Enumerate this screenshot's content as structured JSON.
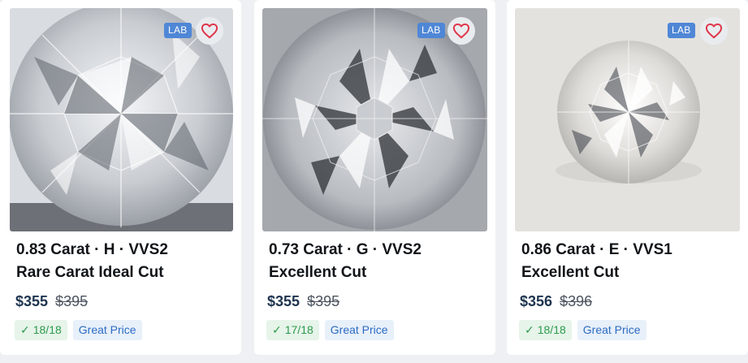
{
  "listings": [
    {
      "badge": "LAB",
      "title_line1": "0.83 Carat · H · VVS2",
      "title_line2": "Rare Carat Ideal Cut",
      "price": "$355",
      "old_price": "$395",
      "score": "18/18",
      "deal_label": "Great Price"
    },
    {
      "badge": "LAB",
      "title_line1": "0.73 Carat · G · VVS2",
      "title_line2": "Excellent Cut",
      "price": "$355",
      "old_price": "$395",
      "score": "17/18",
      "deal_label": "Great Price"
    },
    {
      "badge": "LAB",
      "title_line1": "0.86 Carat · E · VVS1",
      "title_line2": "Excellent Cut",
      "price": "$356",
      "old_price": "$396",
      "score": "18/18",
      "deal_label": "Great Price"
    }
  ],
  "colors": {
    "heart": "#e0364a",
    "badge": "#4f87d6",
    "score_text": "#2e9a4a",
    "deal_text": "#2c6cc2"
  },
  "icons": {
    "favorite": "heart-icon",
    "score": "check-icon"
  }
}
